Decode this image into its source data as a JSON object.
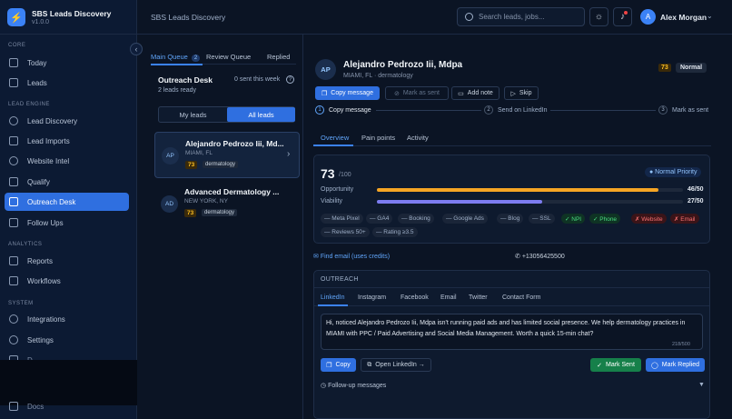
{
  "brand": {
    "name": "SBS Leads Discovery",
    "version": "v1.0.0"
  },
  "sidebar": {
    "sections": [
      {
        "title": "CORE",
        "items": [
          "Today",
          "Leads"
        ]
      },
      {
        "title": "LEAD ENGINE",
        "items": [
          "Lead Discovery",
          "Lead Imports",
          "Website Intel",
          "Qualify",
          "Outreach Desk",
          "Follow Ups"
        ]
      },
      {
        "title": "ANALYTICS",
        "items": [
          "Reports",
          "Workflows"
        ]
      },
      {
        "title": "SYSTEM",
        "items": [
          "Integrations",
          "Settings",
          "D...",
          "Docs"
        ]
      }
    ],
    "active": "Outreach Desk"
  },
  "header": {
    "title": "SBS Leads Discovery",
    "search_placeholder": "Search leads, jobs...",
    "user": {
      "initial": "A",
      "name": "Alex Morgan"
    }
  },
  "queue": {
    "tabs": [
      {
        "label": "Main Queue",
        "badge": "2"
      },
      {
        "label": "Review Queue"
      },
      {
        "label": "Replied"
      }
    ],
    "title": "Outreach Desk",
    "subtitle": "2 leads ready",
    "sent": "0 sent this week",
    "toggle": [
      "My leads",
      "All leads"
    ],
    "leads": [
      {
        "initials": "AP",
        "name": "Alejandro Pedrozo Iii, Md...",
        "location": "MIAMI, FL",
        "score": "73",
        "tag": "dermatology"
      },
      {
        "initials": "AD",
        "name": "Advanced Dermatology ...",
        "location": "NEW YORK, NY",
        "score": "73",
        "tag": "dermatology"
      }
    ]
  },
  "detail": {
    "initials": "AP",
    "name": "Alejandro Pedrozo Iii, Mdpa",
    "subtitle": "MIAMI, FL · dermatology",
    "score": "73",
    "priority": "Normal",
    "actions": [
      "Copy message",
      "Mark as sent",
      "Add note",
      "Skip"
    ],
    "steps": [
      {
        "n": "1",
        "label": "Copy message"
      },
      {
        "n": "2",
        "label": "Send on LinkedIn"
      },
      {
        "n": "3",
        "label": "Mark as sent"
      }
    ],
    "tabs": [
      "Overview",
      "Pain points",
      "Activity"
    ],
    "overview": {
      "score": "73",
      "max": "/100",
      "priority_badge": "● Normal Priority",
      "metrics": [
        {
          "label": "Opportunity",
          "value": "46/50",
          "pct": 0.92,
          "color": "#f5a524"
        },
        {
          "label": "Viability",
          "value": "27/50",
          "pct": 0.54,
          "color": "#7c7cf0"
        }
      ],
      "chips": [
        {
          "text": "— Meta Pixel",
          "kind": "n"
        },
        {
          "text": "— GA4",
          "kind": "n"
        },
        {
          "text": "— Booking",
          "kind": "n"
        },
        {
          "text": "— Google Ads",
          "kind": "n"
        },
        {
          "text": "— Blog",
          "kind": "n"
        },
        {
          "text": "— SSL",
          "kind": "n"
        },
        {
          "text": "✓ NPI",
          "kind": "g"
        },
        {
          "text": "✓ Phone",
          "kind": "g"
        },
        {
          "text": "✗ Website",
          "kind": "r"
        },
        {
          "text": "✗ Email",
          "kind": "r"
        },
        {
          "text": "— Reviews 50+",
          "kind": "n"
        },
        {
          "text": "— Rating ≥3.5",
          "kind": "n"
        }
      ]
    },
    "find_email": "Find email (uses credits)",
    "phone": "+13056425500",
    "outreach": {
      "title": "OUTREACH",
      "channels": [
        "LinkedIn",
        "Instagram",
        "Facebook",
        "Email",
        "Twitter",
        "Contact Form"
      ],
      "message": "Hi, noticed Alejandro Pedrozo Iii, Mdpa isn't running paid ads and has limited social presence. We help dermatology practices in MIAMI with PPC / Paid Advertising and Social Media Management. Worth a quick 15-min chat?",
      "count": "218/500",
      "buttons": {
        "copy": "Copy",
        "open": "Open LinkedIn →",
        "mark_sent": "Mark Sent",
        "mark_replied": "Mark Replied"
      },
      "followups": "Follow-up messages"
    }
  }
}
